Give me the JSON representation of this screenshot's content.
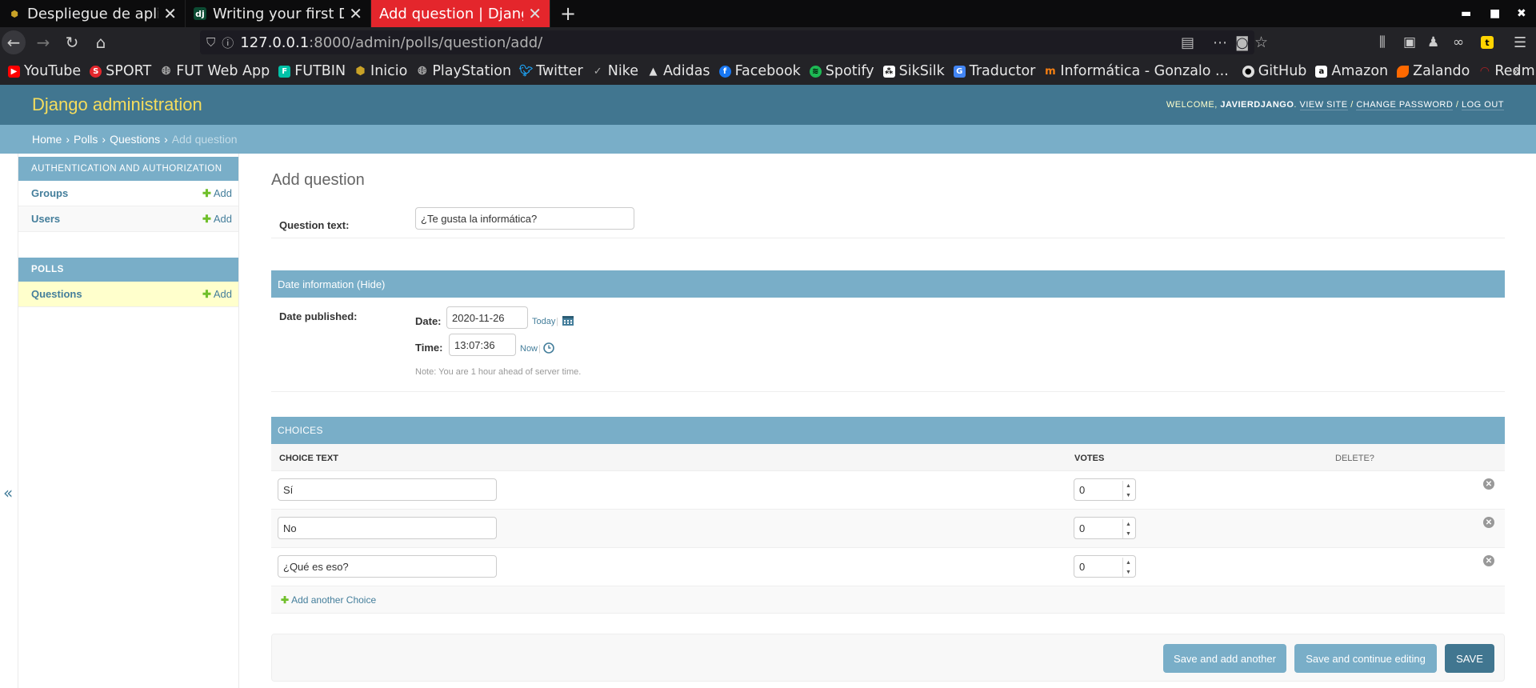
{
  "browser": {
    "tabs": [
      {
        "title": "Despliegue de aplicaci",
        "favicon": "hexagon-icon",
        "active": false
      },
      {
        "title": "Writing your first Djan",
        "favicon": "dj",
        "active": false
      },
      {
        "title": "Add question | Django si",
        "favicon": "",
        "active": true
      }
    ],
    "new_tab": "+",
    "url_host": "127.0.0.1",
    "url_rest": ":8000/admin/polls/question/add/",
    "bookmarks": [
      {
        "label": "YouTube",
        "icon": "youtube-icon",
        "color": "#ff0000"
      },
      {
        "label": "SPORT",
        "icon": "sport-icon",
        "color": "#e4262c"
      },
      {
        "label": "FUT Web App",
        "icon": "globe-icon",
        "color": "#888888"
      },
      {
        "label": "FUTBIN",
        "icon": "futbin-icon",
        "color": "#00c2a8"
      },
      {
        "label": "Inicio",
        "icon": "hexagon-icon",
        "color": "#c9a227"
      },
      {
        "label": "PlayStation",
        "icon": "globe-icon",
        "color": "#888888"
      },
      {
        "label": "Twitter",
        "icon": "twitter-icon",
        "color": "#1da1f2"
      },
      {
        "label": "Nike",
        "icon": "nike-icon",
        "color": "#aaaaaa"
      },
      {
        "label": "Adidas",
        "icon": "adidas-icon",
        "color": "#dddddd"
      },
      {
        "label": "Facebook",
        "icon": "facebook-icon",
        "color": "#1877f2"
      },
      {
        "label": "Spotify",
        "icon": "spotify-icon",
        "color": "#1db954"
      },
      {
        "label": "SikSilk",
        "icon": "siksilk-icon",
        "color": "#ffffff"
      },
      {
        "label": "Traductor",
        "icon": "translate-icon",
        "color": "#4285f4"
      },
      {
        "label": "Informática - Gonzalo ...",
        "icon": "moodle-icon",
        "color": "#f98012"
      },
      {
        "label": "GitHub",
        "icon": "github-icon",
        "color": "#dddddd"
      },
      {
        "label": "Amazon",
        "icon": "amazon-icon",
        "color": "#ff9900"
      },
      {
        "label": "Zalando",
        "icon": "zalando-icon",
        "color": "#ff6900"
      },
      {
        "label": "Redmine",
        "icon": "redmine-icon",
        "color": "#b32024"
      }
    ]
  },
  "header": {
    "site_name": "Django administration",
    "welcome": "Welcome,",
    "username": "javierdjango",
    "view_site": "View site",
    "change_password": "Change password",
    "log_out": "Log out",
    "sep": "/"
  },
  "breadcrumbs": {
    "home": "Home",
    "polls": "Polls",
    "questions": "Questions",
    "current": "Add question",
    "sep": "›"
  },
  "sidebar": {
    "auth_caption": "Authentication and Authorization",
    "auth_items": [
      {
        "name": "Groups",
        "add": "Add"
      },
      {
        "name": "Users",
        "add": "Add"
      }
    ],
    "polls_caption": "Polls",
    "polls_items": [
      {
        "name": "Questions",
        "add": "Add"
      }
    ],
    "collapse": "«"
  },
  "form": {
    "title": "Add question",
    "question_label": "Question text:",
    "question_value": "¿Te gusta la informática?",
    "date_fieldset": "Date information (Hide)",
    "date_published_label": "Date published:",
    "date_label": "Date:",
    "date_value": "2020-11-26",
    "today_link": "Today",
    "time_label": "Time:",
    "time_value": "13:07:36",
    "now_link": "Now",
    "link_sep": "|",
    "timezone_note": "Note: You are 1 hour ahead of server time.",
    "choices_caption": "Choices",
    "col_choice_text": "Choice text",
    "col_votes": "Votes",
    "col_delete": "Delete?",
    "choices": [
      {
        "text": "Sí",
        "votes": "0"
      },
      {
        "text": "No",
        "votes": "0"
      },
      {
        "text": "¿Qué es eso?",
        "votes": "0"
      }
    ],
    "add_another": "Add another Choice",
    "save_add_another": "Save and add another",
    "save_continue": "Save and continue editing",
    "save": "SAVE"
  }
}
